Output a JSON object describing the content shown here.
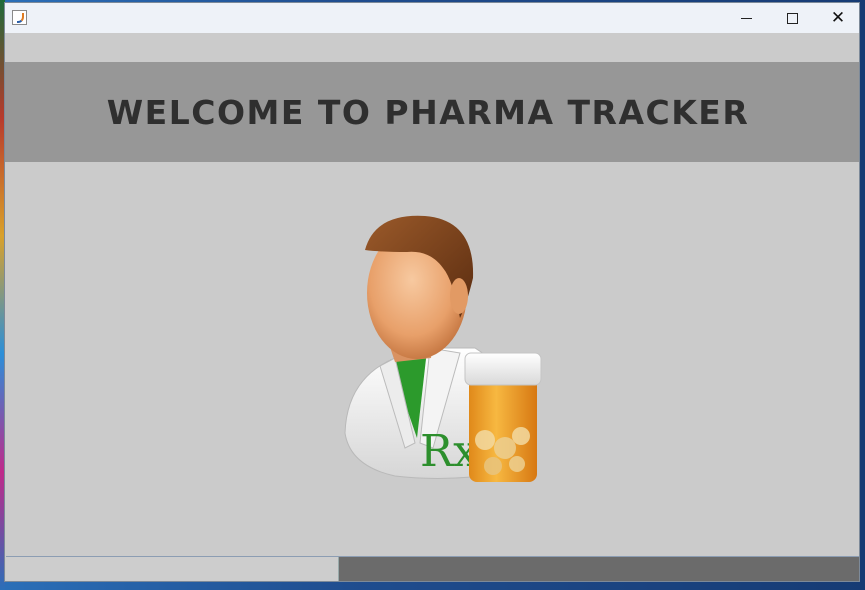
{
  "window": {
    "title": "",
    "minimize_label": "",
    "maximize_label": "",
    "close_label": "✕"
  },
  "banner": {
    "heading": "WELCOME TO PHARMA TRACKER"
  },
  "illustration": {
    "icon": "pharmacist-rx-icon",
    "badge_text": "Rx"
  },
  "progress": {
    "fraction": 0.39
  },
  "colors": {
    "window_bg": "#cbcbcb",
    "banner_bg": "#979797",
    "heading_text": "#2f2f2f",
    "progress_track": "#6b6b6b",
    "progress_fill": "#cdcdcd"
  }
}
